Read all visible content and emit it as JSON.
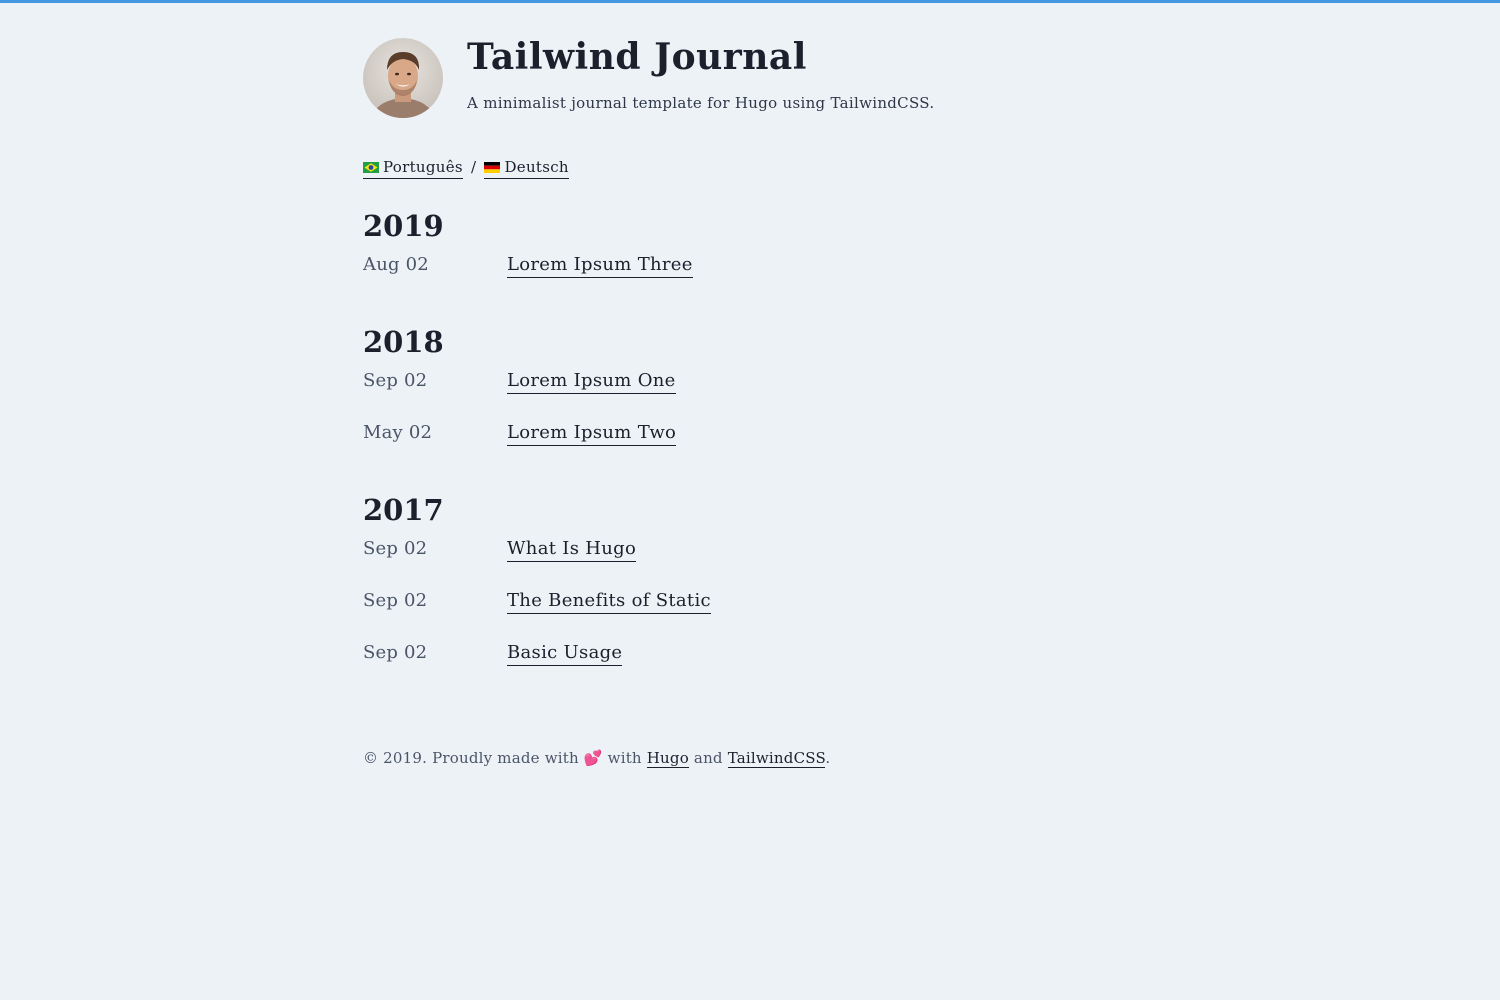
{
  "site": {
    "title": "Tailwind Journal",
    "subtitle": "A minimalist journal template for Hugo using TailwindCSS."
  },
  "languages": {
    "items": [
      {
        "label": "Português",
        "flag": "brazil-flag-icon"
      },
      {
        "label": "Deutsch",
        "flag": "germany-flag-icon"
      }
    ],
    "separator": "/"
  },
  "archive": [
    {
      "year": "2019",
      "posts": [
        {
          "date": "Aug 02",
          "title": "Lorem Ipsum Three"
        }
      ]
    },
    {
      "year": "2018",
      "posts": [
        {
          "date": "Sep 02",
          "title": "Lorem Ipsum One"
        },
        {
          "date": "May 02",
          "title": "Lorem Ipsum Two"
        }
      ]
    },
    {
      "year": "2017",
      "posts": [
        {
          "date": "Sep 02",
          "title": "What Is Hugo"
        },
        {
          "date": "Sep 02",
          "title": "The Benefits of Static"
        },
        {
          "date": "Sep 02",
          "title": "Basic Usage"
        }
      ]
    }
  ],
  "footer": {
    "prefix": "© 2019. Proudly made with",
    "heart": "💕",
    "with": "with",
    "link1": "Hugo",
    "and": "and",
    "link2": "TailwindCSS",
    "suffix": "."
  },
  "colors": {
    "background": "#edf2f7",
    "accent": "#4299e1",
    "heading": "#1a202c",
    "text": "#4a5568",
    "heart": "#e53e3e"
  }
}
